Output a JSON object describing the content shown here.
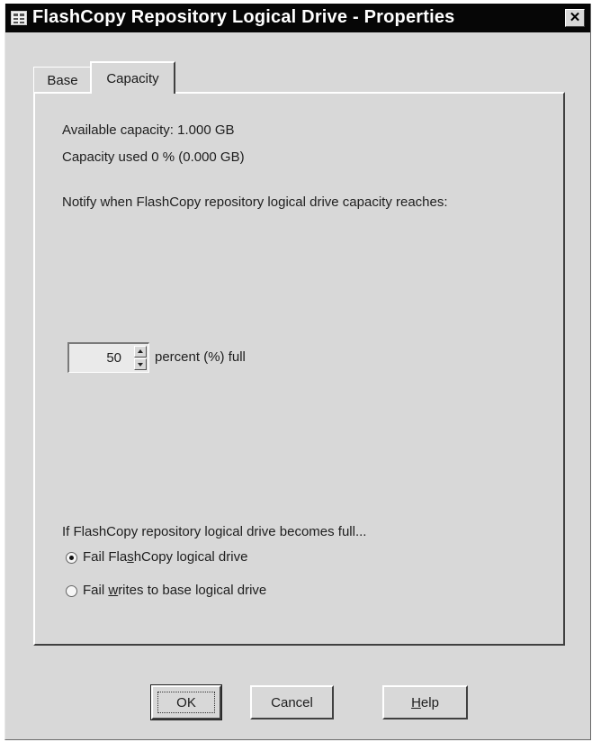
{
  "window": {
    "title": "FlashCopy Repository Logical Drive - Properties",
    "close_glyph": "✕"
  },
  "tabs": [
    {
      "label": "Base",
      "selected": false
    },
    {
      "label": "Capacity",
      "selected": true
    }
  ],
  "capacity": {
    "available": "Available capacity: 1.000 GB",
    "used": "Capacity used 0 % (0.000 GB)",
    "notify_label": "Notify when FlashCopy repository logical drive capacity reaches:",
    "threshold_value": "50",
    "threshold_suffix": "percent (%) full",
    "full_policy_label": "If FlashCopy repository logical drive becomes full...",
    "options": [
      {
        "pre": "Fail Fla",
        "mnemonic": "s",
        "post": "hCopy logical drive",
        "checked": true
      },
      {
        "pre": "Fail ",
        "mnemonic": "w",
        "post": "rites to base logical drive",
        "checked": false
      }
    ]
  },
  "buttons": {
    "ok": "OK",
    "cancel": "Cancel",
    "help_mnemonic": "H",
    "help_rest": "elp"
  },
  "icons": {
    "app": "grid-app-icon",
    "close": "close-icon",
    "spin_up": "spin-up-arrow-icon",
    "spin_down": "spin-down-arrow-icon"
  }
}
